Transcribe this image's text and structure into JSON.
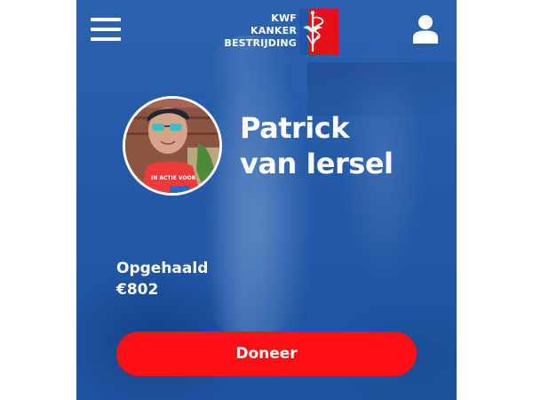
{
  "header": {
    "menu_icon": "hamburger-menu-icon",
    "logo": {
      "lines": [
        "KWF",
        "KANKER",
        "BESTRIJDING"
      ]
    },
    "account_icon": "user-icon"
  },
  "profile": {
    "name_line1": "Patrick",
    "name_line2": "van Iersel"
  },
  "fundraising": {
    "raised_label": "Opgehaald",
    "raised_amount": "€802"
  },
  "donate_button": {
    "label": "Doneer"
  },
  "colors": {
    "brand_blue": "#1f56a6",
    "button_red": "#ff0f14",
    "logo_red": "#e3101a",
    "text": "#ffffff"
  }
}
